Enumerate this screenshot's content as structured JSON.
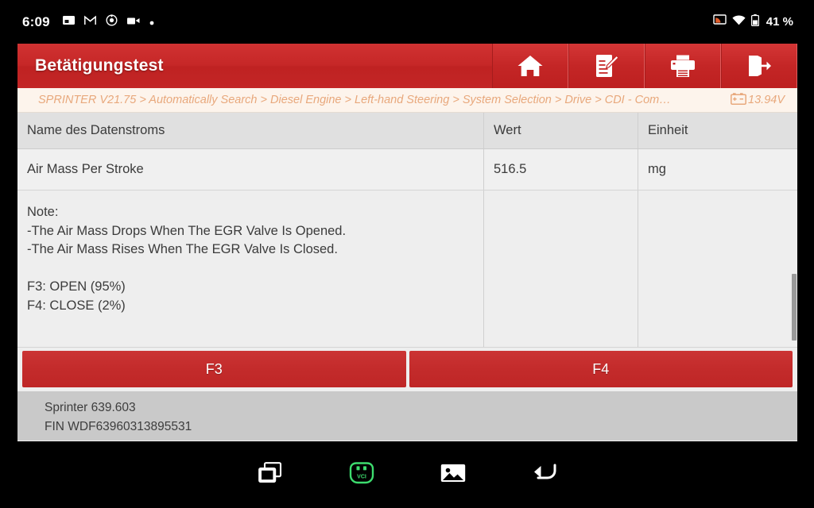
{
  "statusbar": {
    "clock": "6:09",
    "left_icons": [
      "screenshot-icon",
      "gmail-icon",
      "app-icon",
      "screen-record-icon",
      "dot-icon"
    ],
    "right_icons": [
      "cast-icon",
      "wifi-icon",
      "battery-icon"
    ],
    "battery_text": "41 %"
  },
  "header": {
    "title": "Betätigungstest",
    "buttons": [
      {
        "name": "home-button",
        "icon": "home-icon"
      },
      {
        "name": "report-button",
        "icon": "edit-report-icon"
      },
      {
        "name": "print-button",
        "icon": "printer-icon"
      },
      {
        "name": "exit-button",
        "icon": "exit-icon"
      }
    ]
  },
  "breadcrumb": {
    "path": "SPRINTER V21.75 > Automatically Search > Diesel Engine > Left-hand Steering > System Selection > Drive > CDI -  Com…",
    "voltage": "13.94V",
    "voltage_icon": "car-battery-icon"
  },
  "table": {
    "columns": [
      "Name des Datenstroms",
      "Wert",
      "Einheit"
    ],
    "rows": [
      {
        "name": "Air Mass Per Stroke",
        "value": "516.5",
        "unit": "mg"
      }
    ],
    "note": {
      "text": "Note:\n-The Air Mass Drops When The EGR Valve Is Opened.\n-The Air Mass Rises When The EGR Valve Is Closed.\n\nF3: OPEN (95%)\nF4: CLOSE (2%)",
      "value": "",
      "unit": ""
    }
  },
  "actions": {
    "buttons": [
      {
        "label": "F3"
      },
      {
        "label": "F4"
      }
    ]
  },
  "vehicle_info": {
    "model": "Sprinter 639.603",
    "vin": "FIN WDF63960313895531"
  },
  "navbar": {
    "items": [
      {
        "name": "recents-icon"
      },
      {
        "name": "vci-connector-icon",
        "label": "VCI"
      },
      {
        "name": "gallery-icon"
      },
      {
        "name": "back-icon"
      }
    ]
  },
  "colors": {
    "brand_red": "#c62727",
    "breadcrumb_bg": "#fdf4ec",
    "breadcrumb_text": "#e8a87c",
    "vci_green": "#3ddc6e"
  }
}
